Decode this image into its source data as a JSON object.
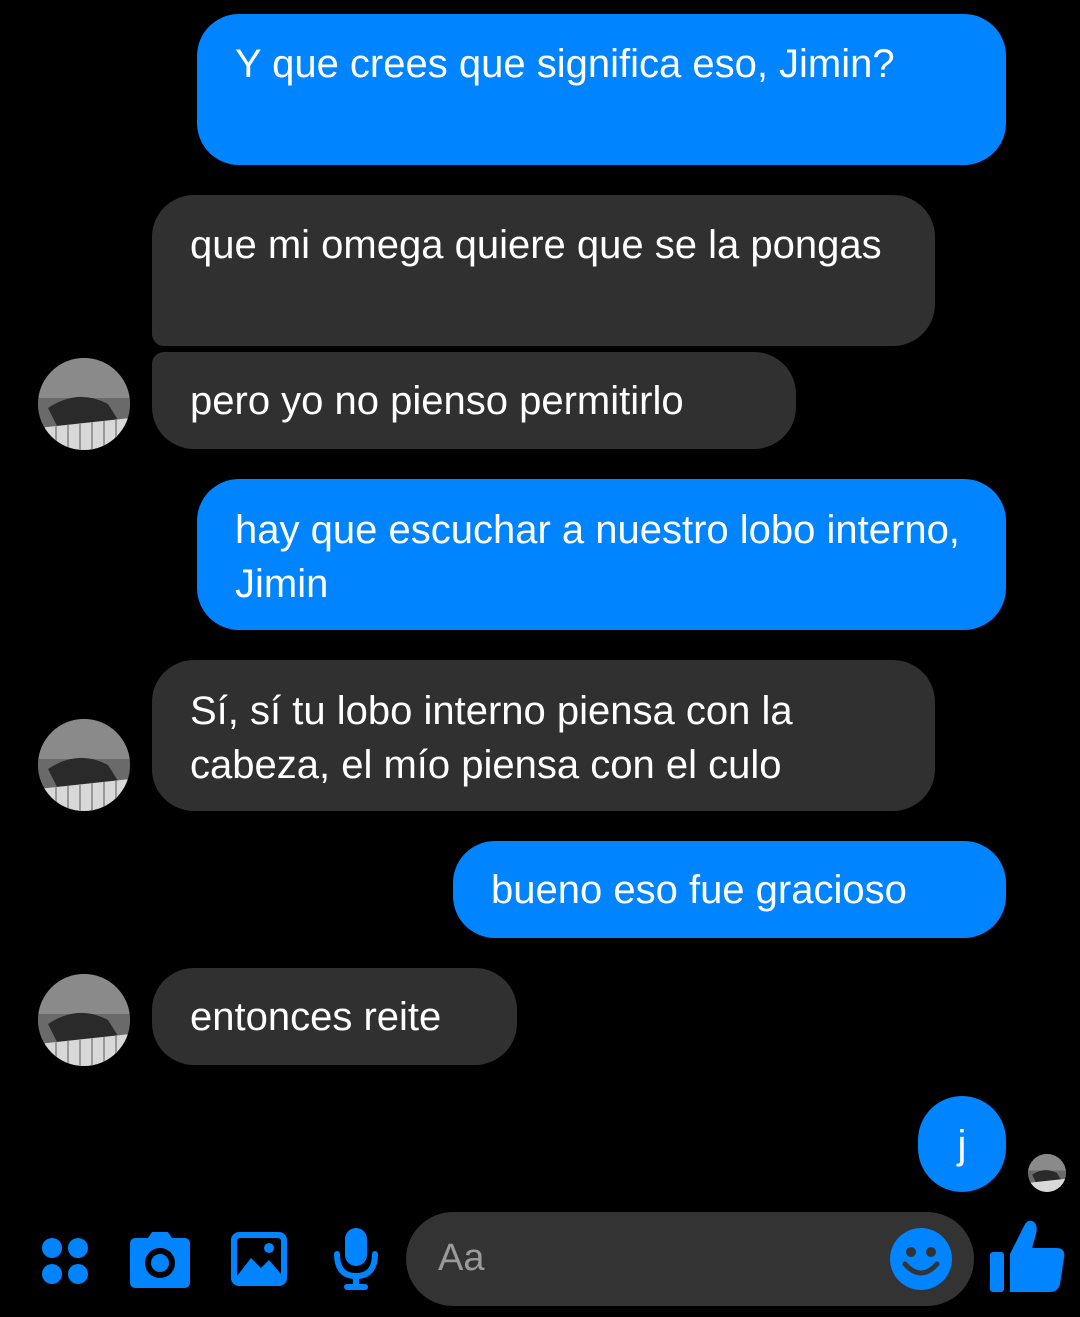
{
  "conversation": {
    "messages": [
      {
        "from": "me",
        "text": "Y que crees que significa eso, Jimin?"
      },
      {
        "from": "them",
        "text": "que mi omega quiere que se la pongas"
      },
      {
        "from": "them",
        "text": "pero yo no pienso permitirlo"
      },
      {
        "from": "me",
        "text": "hay que escuchar a nuestro lobo interno, Jimin"
      },
      {
        "from": "them",
        "text": "Sí, sí tu lobo interno piensa con la cabeza, el mío piensa con el culo"
      },
      {
        "from": "me",
        "text": "bueno eso fue gracioso"
      },
      {
        "from": "them",
        "text": "entonces reite"
      },
      {
        "from": "me",
        "text": "j"
      }
    ]
  },
  "composer": {
    "placeholder": "Aa",
    "icons": [
      "menu-dots-icon",
      "camera-icon",
      "gallery-icon",
      "microphone-icon",
      "emoji-icon",
      "thumbs-up-icon"
    ]
  },
  "colors": {
    "background": "#000000",
    "outgoing_bubble": "#0084ff",
    "incoming_bubble": "#303030",
    "accent": "#0084ff"
  }
}
